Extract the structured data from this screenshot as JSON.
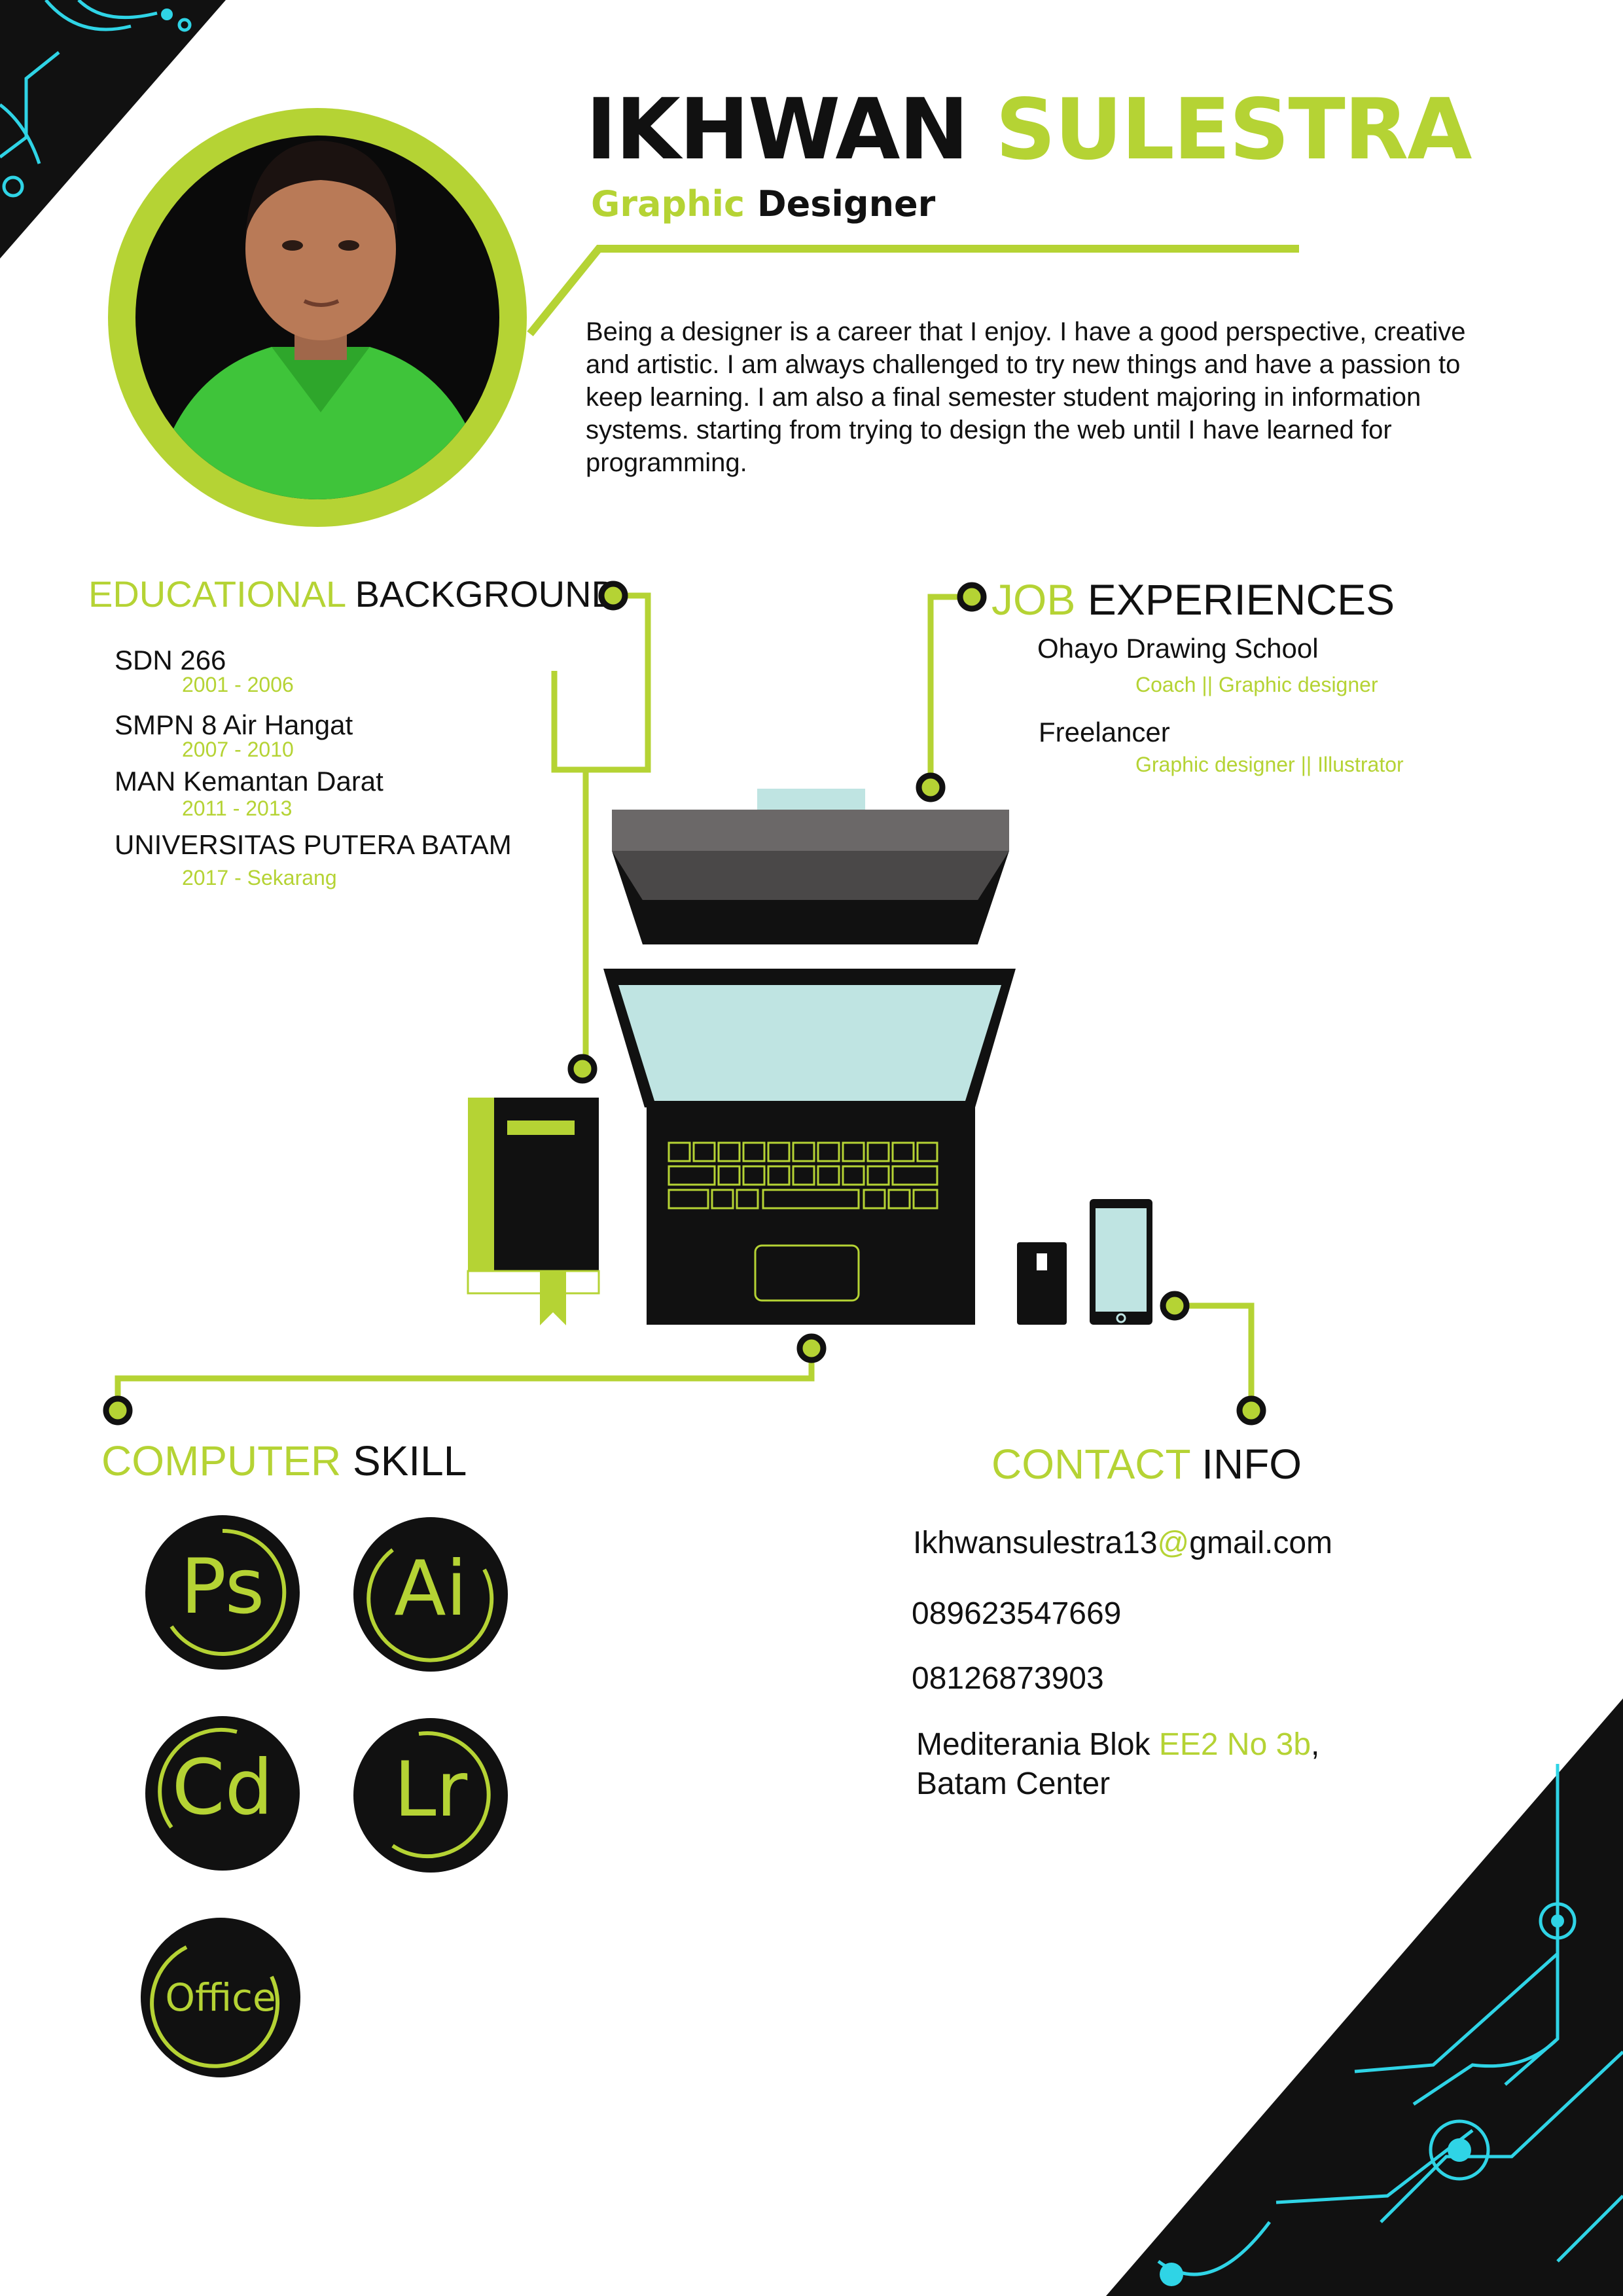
{
  "header": {
    "first_name": "IKHWAN",
    "last_name": "SULESTRA",
    "role_highlight": "Graphic",
    "role_rest": "Designer"
  },
  "bio": "Being a designer is a career that I enjoy. I have a good perspective, creative and artistic. I am always challenged to try new things and have a passion to keep learning. I am also a final semester student majoring in information systems. starting from trying to design the web until I have learned for programming.",
  "education": {
    "title_highlight": "EDUCATIONAL",
    "title_rest": "BACKGROUND",
    "items": [
      {
        "school": "SDN 266",
        "years": "2001 - 2006"
      },
      {
        "school": "SMPN 8 Air Hangat",
        "years": "2007 - 2010"
      },
      {
        "school": "MAN Kemantan Darat",
        "years": "2011 - 2013"
      },
      {
        "school": "UNIVERSITAS PUTERA BATAM",
        "years": "2017 - Sekarang"
      }
    ]
  },
  "jobs": {
    "title_highlight": "JOB",
    "title_rest": "EXPERIENCES",
    "items": [
      {
        "company": "Ohayo Drawing School",
        "role": "Coach || Graphic designer"
      },
      {
        "company": "Freelancer",
        "role": "Graphic designer || Illustrator"
      }
    ]
  },
  "skills": {
    "title_highlight": "COMPUTER",
    "title_rest": "SKILL",
    "items": [
      {
        "label": "Ps",
        "icon": "photoshop-icon"
      },
      {
        "label": "Ai",
        "icon": "illustrator-icon"
      },
      {
        "label": "Cd",
        "icon": "coreldraw-icon"
      },
      {
        "label": "Lr",
        "icon": "lightroom-icon"
      },
      {
        "label": "Office",
        "icon": "office-icon"
      }
    ]
  },
  "contact": {
    "title_highlight": "CONTACT",
    "title_rest": "INFO",
    "email_user": "Ikhwansulestra13",
    "email_at": "@",
    "email_domain": "gmail.com",
    "phone_1": "089623547669",
    "phone_2": "08126873903",
    "address_part1": "Mediterania Blok ",
    "address_highlight": "EE2 No 3b",
    "address_comma": ",",
    "address_line2": "Batam Center"
  },
  "colors": {
    "accent": "#b5d334",
    "dark": "#111111",
    "circuit": "#2fd4e6",
    "screen": "#bfe4e2"
  }
}
